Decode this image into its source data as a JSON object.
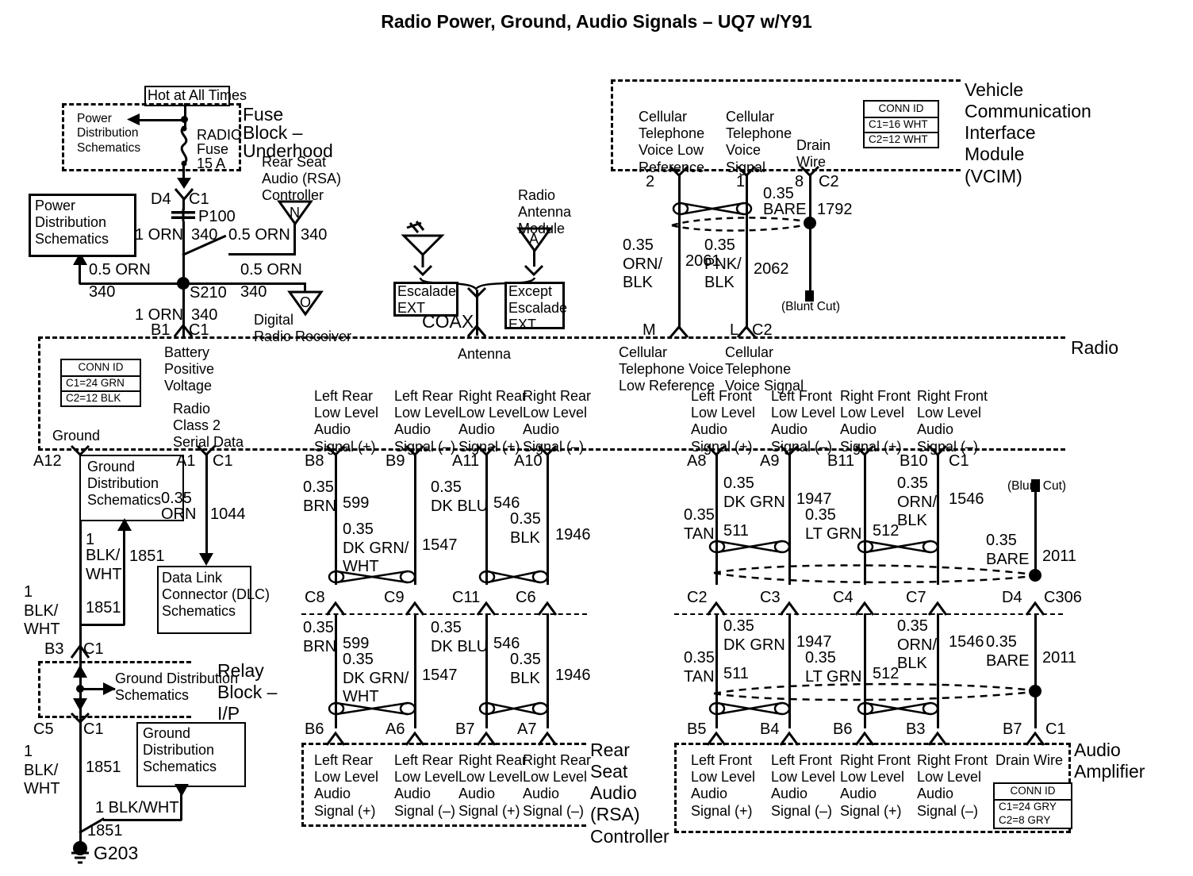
{
  "title": "Radio Power, Ground, Audio Signals – UQ7 w/Y91",
  "fuse_block": {
    "hot_label": "Hot at All Times",
    "block_name_l1": "Fuse",
    "block_name_l2": "Block –",
    "block_name_l3": "Underhood",
    "pds_inside": "Power\nDistribution\nSchematics",
    "fuse_name": "RADIO",
    "fuse_l2": "Fuse",
    "fuse_rating": "15 A",
    "pds_box": "Power\nDistribution\nSchematics",
    "term_d4": "D4",
    "term_c1": "C1",
    "splice_p100": "P100",
    "w_1orn": "1 ORN",
    "w_340a": "340",
    "w_05orn_rsa": "0.5 ORN",
    "w_340b": "340",
    "rsa_label": "Rear Seat\nAudio (RSA)\nController",
    "rsa_ref": "N",
    "w_05orn_left": "0.5 ORN",
    "w_340_left": "340",
    "splice_s210": "S210",
    "w_05orn_right": "0.5 ORN",
    "w_340_right": "340",
    "drr_ref": "O",
    "drr_label": "Digital\nRadio Receiver",
    "w_1orn_b": "1 ORN",
    "w_340_b": "340",
    "term_b1": "B1",
    "term_c1b": "C1"
  },
  "antenna": {
    "escalade_box": "Escalade\nEXT",
    "except_box": "Except\nEscalade\nEXT",
    "coax": "COAX",
    "ram_label": "Radio\nAntenna\nModule",
    "ram_ref": "A"
  },
  "vcim": {
    "name": "Vehicle\nCommunication\nInterface\nModule\n(VCIM)",
    "pin2_label": "Cellular\nTelephone\nVoice Low\nReference",
    "pin1_label": "Cellular\nTelephone\nVoice\nSignal",
    "pin8_label": "Drain\nWire",
    "conn_id_header": "CONN ID",
    "conn_c1": "C1=16 WHT",
    "conn_c2": "C2=12 WHT",
    "pin2": "2",
    "pin1": "1",
    "pin8": "8",
    "conn_c2_top": "C2",
    "w_bare_size": "0.35",
    "w_bare_color": "BARE",
    "w_bare_num": "1792",
    "w_orn_blk": "0.35\nORN/\nBLK",
    "w_2061": "2061",
    "w_pnk_blk": "0.35\nPNK/\nBLK",
    "w_2062": "2062",
    "blunt_cut": "(Blunt Cut)",
    "term_m": "M",
    "term_l": "L",
    "term_c2_bot": "C2"
  },
  "radio": {
    "name": "Radio",
    "conn_id_header": "CONN ID",
    "conn_c1": "C1=24 GRN",
    "conn_c2": "C2=12 BLK",
    "ground_label": "Ground",
    "battery_label": "Battery\nPositive\nVoltage",
    "class2_label": "Radio\nClass 2\nSerial Data",
    "antenna_label": "Antenna",
    "cell_low_ref": "Cellular\nTelephone Voice\nLow Reference",
    "cell_voice": "Cellular\nTelephone\nVoice Signal",
    "pin_labels": [
      "Left Rear\nLow Level\nAudio\nSignal (+)",
      "Left Rear\nLow Level\nAudio\nSignal (–)",
      "Right Rear\nLow Level\nAudio\nSignal (+)",
      "Right Rear\nLow Level\nAudio\nSignal (–)",
      "Left Front\nLow Level\nAudio\nSignal (+)",
      "Left Front\nLow Level\nAudio\nSignal (–)",
      "Right Front\nLow Level\nAudio\nSignal (+)",
      "Right Front\nLow Level\nAudio\nSignal (–)"
    ]
  },
  "ground_left": {
    "a12": "A12",
    "gds_box1": "Ground\nDistribution\nSchematics",
    "w1_size": "1",
    "w1_color": "BLK/\nWHT",
    "w1_num": "1851",
    "w2_label": "1\nBLK/\nWHT",
    "w2_num": "1851",
    "b3": "B3",
    "c1": "C1",
    "relay_block": "Relay\nBlock –\nI/P",
    "relay_inside": "Ground Distribution\nSchematics",
    "c5": "C5",
    "c1b": "C1",
    "w3_label": "1\nBLK/\nWHT",
    "w3_num": "1851",
    "gds_box2": "Ground\nDistribution\nSchematics",
    "w4_label": "1 BLK/WHT",
    "w4_num": "1851",
    "ground_id": "G203"
  },
  "dlc": {
    "a1": "A1",
    "c1": "C1",
    "w_size": "0.35",
    "w_color": "ORN",
    "w_num": "1044",
    "box": "Data Link\nConnector (DLC)\nSchematics"
  },
  "rear_bundle": {
    "top_pins": [
      "B8",
      "B9",
      "A11",
      "A10"
    ],
    "mid_pins": [
      "C8",
      "C9",
      "C11",
      "C6"
    ],
    "bot_pins": [
      "B6",
      "A6",
      "B7",
      "A7"
    ],
    "upper_wires": [
      {
        "spec": "0.35\nBRN",
        "num": "599"
      },
      {
        "spec": "0.35\nDK GRN/\nWHT",
        "num": "1547"
      },
      {
        "spec": "0.35\nDK BLU",
        "num": "546"
      },
      {
        "spec": "0.35\nBLK",
        "num": "1946"
      }
    ],
    "lower_wires": [
      {
        "spec": "0.35\nBRN",
        "num": "599"
      },
      {
        "spec": "0.35\nDK GRN/\nWHT",
        "num": "1547"
      },
      {
        "spec": "0.35\nDK BLU",
        "num": "546"
      },
      {
        "spec": "0.35\nBLK",
        "num": "1946"
      }
    ]
  },
  "front_bundle": {
    "top_pins": [
      "A8",
      "A9",
      "B11",
      "B10"
    ],
    "top_conn": "C1",
    "mid_pins": [
      "C2",
      "C3",
      "C4",
      "C7"
    ],
    "mid_d4": "D4",
    "mid_conn": "C306",
    "bot_pins": [
      "B5",
      "B4",
      "B6",
      "B3"
    ],
    "bot_drain_pin": "B7",
    "bot_conn": "C1",
    "upper_wires": [
      {
        "spec": "0.35\nTAN",
        "num": "511"
      },
      {
        "spec": "0.35\nDK GRN",
        "num": "1947"
      },
      {
        "spec": "0.35\nLT GRN",
        "num": "512"
      },
      {
        "spec": "0.35\nORN/\nBLK",
        "num": "1546"
      }
    ],
    "lower_wires": [
      {
        "spec": "0.35\nTAN",
        "num": "511"
      },
      {
        "spec": "0.35\nDK GRN",
        "num": "1947"
      },
      {
        "spec": "0.35\nLT GRN",
        "num": "512"
      },
      {
        "spec": "0.35\nORN/\nBLK",
        "num": "1546"
      }
    ],
    "drain_blunt_cut": "(Blunt Cut)",
    "drain_spec_upper": "0.35\nBARE",
    "drain_num_upper": "2011",
    "drain_spec_lower": "0.35\nBARE",
    "drain_num_lower": "2011"
  },
  "rsa": {
    "name": "Rear\nSeat\nAudio\n(RSA)\nController",
    "pin_labels": [
      "Left Rear\nLow Level\nAudio\nSignal (+)",
      "Left Rear\nLow Level\nAudio\nSignal (–)",
      "Right Rear\nLow Level\nAudio\nSignal (+)",
      "Right Rear\nLow Level\nAudio\nSignal (–)"
    ]
  },
  "amplifier": {
    "name": "Audio\nAmplifier",
    "pin_labels": [
      "Left Front\nLow Level\nAudio\nSignal (+)",
      "Left Front\nLow Level\nAudio\nSignal (–)",
      "Right Front\nLow Level\nAudio\nSignal (+)",
      "Right Front\nLow Level\nAudio\nSignal (–)",
      "Drain Wire"
    ],
    "conn_id_header": "CONN ID",
    "conn_c1": "C1=24 GRY",
    "conn_c2": "C2=8 GRY"
  }
}
